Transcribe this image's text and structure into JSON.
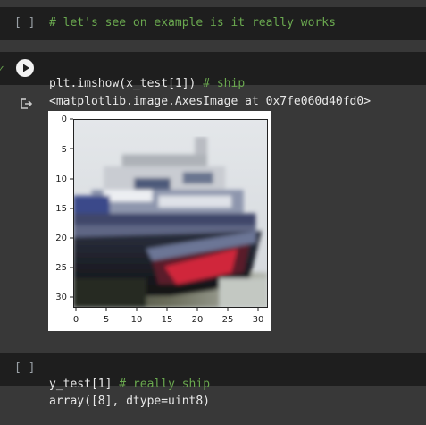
{
  "cells": {
    "cell1": {
      "bracket": "[ ]",
      "code": "# let's see on example is it really works"
    },
    "cell2": {
      "code": "plt.imshow(x_test[1])",
      "comment": "# ship",
      "output": "<matplotlib.image.AxesImage at 0x7fe060d40fd0>"
    },
    "cell3": {
      "bracket": "[ ]",
      "code": "y_test[1]",
      "comment": "# really ship",
      "output": "array([8], dtype=uint8)"
    }
  },
  "plot": {
    "x_ticks": [
      "0",
      "5",
      "10",
      "15",
      "20",
      "25",
      "30"
    ],
    "y_ticks": [
      "0",
      "5",
      "10",
      "15",
      "20",
      "25",
      "30"
    ]
  },
  "colors": {
    "cell_bg": "#1e1e1e",
    "page_bg": "#383838",
    "comment": "#6aa84f"
  }
}
